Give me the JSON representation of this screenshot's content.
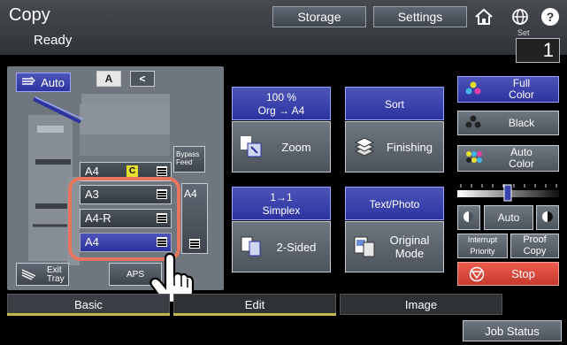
{
  "header": {
    "app_title": "Copy",
    "status": "Ready",
    "storage_label": "Storage",
    "settings_label": "Settings",
    "set_label": "Set",
    "set_value": "1"
  },
  "left_panel": {
    "auto_label": "Auto",
    "mode_icon_1": "A",
    "mode_icon_2": "<",
    "current_paper_label": "A4",
    "current_paper_badge": "C",
    "trays": [
      {
        "label": "A3"
      },
      {
        "label": "A4-R"
      },
      {
        "label": "A4",
        "selected": true
      }
    ],
    "bypass_label_1": "Bypass",
    "bypass_label_2": "Feed",
    "bypass_tray_label": "A4",
    "exit_tray_label_1": "Exit",
    "exit_tray_label_2": "Tray",
    "aps_label": "APS"
  },
  "functions": {
    "zoom": {
      "top_line_1": "100 %",
      "top_line_2": "Org  →  A4",
      "label": "Zoom"
    },
    "finishing": {
      "top_line_1": "Sort",
      "label": "Finishing"
    },
    "duplex": {
      "top_line_1": "1→1",
      "top_line_2": "Simplex",
      "label": "2-Sided"
    },
    "original": {
      "top_line_1": "Text/Photo",
      "label_1": "Original",
      "label_2": "Mode"
    }
  },
  "right_panel": {
    "full_color_1": "Full",
    "full_color_2": "Color",
    "black_label": "Black",
    "auto_color_1": "Auto",
    "auto_color_2": "Color",
    "density_auto": "Auto",
    "interrupt_1": "Interrupt",
    "interrupt_2": "Priority",
    "proof_1": "Proof",
    "proof_2": "Copy",
    "stop_label": "Stop"
  },
  "tabs": [
    {
      "label": "Basic",
      "active": true
    },
    {
      "label": "Edit",
      "active": false
    },
    {
      "label": "Image",
      "active": false
    }
  ],
  "job_status_label": "Job Status",
  "colors": {
    "accent_blue": "#3a42ad",
    "stop_red": "#e0473b",
    "highlight": "#e8765f",
    "tab_underline": "#c7b64a"
  }
}
